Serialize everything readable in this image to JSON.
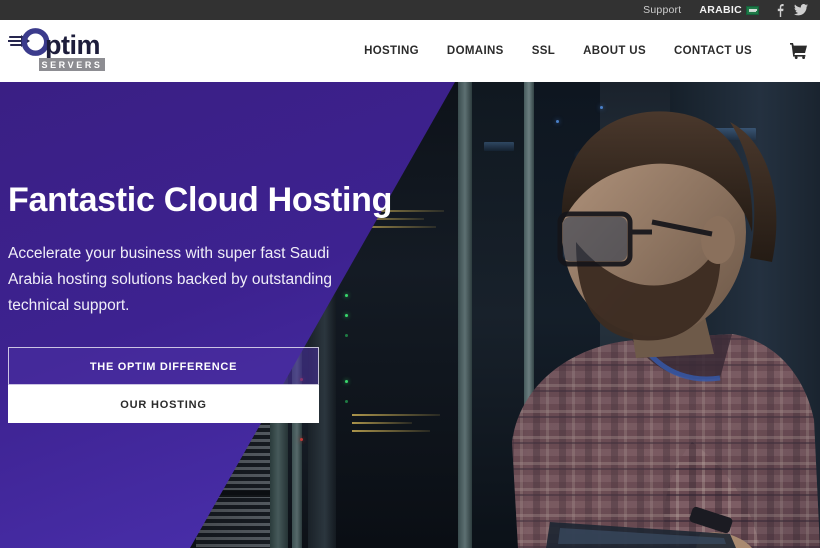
{
  "topbar": {
    "support_label": "Support",
    "language_label": "ARABIC",
    "flag_icon": "saudi-arabia-flag-icon",
    "social": [
      {
        "name": "facebook-icon",
        "label": "f"
      },
      {
        "name": "twitter-icon",
        "label": ""
      }
    ],
    "bg_color": "#323232"
  },
  "header": {
    "logo": {
      "word": "Optim",
      "tagline": "SERVERS",
      "mark": "optim-swoosh-icon"
    },
    "nav": [
      {
        "label": "HOSTING",
        "name": "nav-item-hosting"
      },
      {
        "label": "DOMAINS",
        "name": "nav-item-domains"
      },
      {
        "label": "SSL",
        "name": "nav-item-ssl"
      },
      {
        "label": "ABOUT US",
        "name": "nav-item-about-us"
      },
      {
        "label": "CONTACT US",
        "name": "nav-item-contact-us"
      }
    ],
    "cart_icon": "shopping-cart-icon",
    "bg_color": "#ffffff"
  },
  "hero": {
    "title": "Fantastic Cloud Hosting",
    "subtitle": "Accelerate your business with super fast Saudi Arabia hosting solutions backed by outstanding technical support.",
    "primary_button": "THE OPTIM DIFFERENCE",
    "secondary_button": "OUR HOSTING",
    "overlay_color": "#3d2290",
    "overlay_color_light": "#4e35b4",
    "background_description": "server-room-technician-photo"
  }
}
